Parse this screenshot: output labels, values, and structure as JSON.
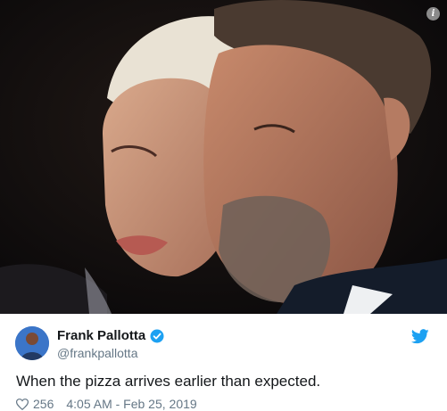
{
  "tweet": {
    "author_name": "Frank Pallotta",
    "author_handle": "@frankpallotta",
    "verified": true,
    "text": "When the pizza arrives earlier than expected.",
    "like_count": "256",
    "timestamp": "4:05 AM - Feb 25, 2019"
  },
  "icons": {
    "info": "info-icon",
    "verified": "verified-badge-icon",
    "twitter": "twitter-bird-icon",
    "like": "heart-icon"
  },
  "colors": {
    "twitter_blue": "#1da1f2",
    "text_primary": "#14171a",
    "text_secondary": "#657786"
  }
}
